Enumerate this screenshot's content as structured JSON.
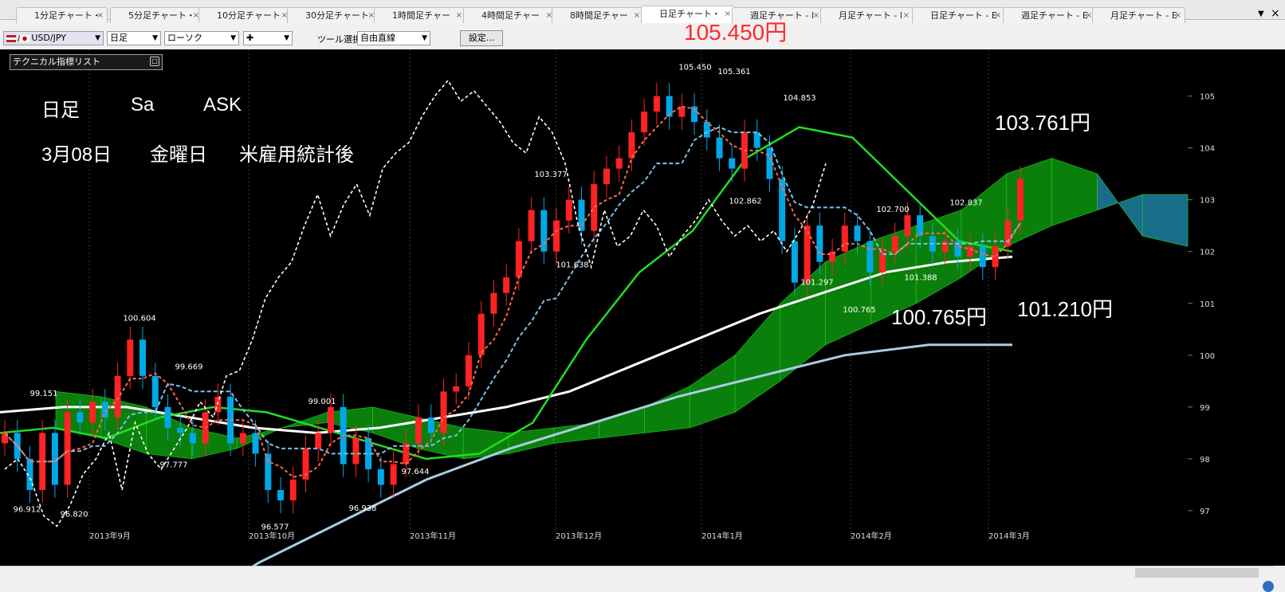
{
  "tabs": [
    {
      "label": "1分足チャート・",
      "active": false
    },
    {
      "label": "5分足チャート・",
      "active": false
    },
    {
      "label": "10分足チャート",
      "active": false
    },
    {
      "label": "30分足チャート",
      "active": false
    },
    {
      "label": "1時間足チャー",
      "active": false
    },
    {
      "label": "4時間足チャー",
      "active": false
    },
    {
      "label": "8時間足チャー",
      "active": false
    },
    {
      "label": "日足チャート・",
      "active": true
    },
    {
      "label": "週足チャート - l",
      "active": false
    },
    {
      "label": "月足チャート - l",
      "active": false
    },
    {
      "label": "日足チャート - E",
      "active": false
    },
    {
      "label": "週足チャート - E",
      "active": false
    },
    {
      "label": "月足チャート - E",
      "active": false
    }
  ],
  "toolbar": {
    "currency": "USD/JPY",
    "timeframe": "日足",
    "chart_style": "ローソク",
    "cursor_mode": "✚",
    "tool_label": "ツール選択",
    "tool_select": "自由直線",
    "settings_label": "設定..."
  },
  "price_header": "105.450円",
  "indicator_list": "テクニカル指標リスト",
  "annotations": {
    "line1": [
      "日足",
      "Sa",
      "ASK"
    ],
    "line2": [
      "3月08日",
      "金曜日",
      "米雇用統計後"
    ],
    "price_current": "103.761円",
    "price_low": "100.765円",
    "price_ma": "101.210円"
  },
  "colors": {
    "bull_candle": "#ff2323",
    "bear_candle": "#00a8e8",
    "kumo_bull": "#0b7f0b",
    "kumo_bear": "#186d89",
    "tenkan": "#ff6b4d",
    "kijun": "#7ec0e8",
    "chikou": "#ffffff",
    "ma_short": "#22dd22",
    "ma_long": "#ffffff",
    "ma_longer": "#a9cde4"
  },
  "chart_data": {
    "type": "candlestick",
    "title": "",
    "xlabel": "",
    "ylabel": "",
    "ylim": [
      96.4,
      105.9
    ],
    "y_ticks": [
      97,
      98,
      99,
      100,
      101,
      102,
      103,
      104,
      105
    ],
    "x_ticks": [
      "2013年9月",
      "2013年10月",
      "2013年11月",
      "2013年12月",
      "2014年1月",
      "2014年2月",
      "2014年3月"
    ],
    "grid": "vertical-dotted",
    "price_labels": [
      {
        "text": "105.450",
        "value": 105.45
      },
      {
        "text": "105.361",
        "value": 105.361
      },
      {
        "text": "104.853",
        "value": 104.853
      },
      {
        "text": "103.377",
        "value": 103.377
      },
      {
        "text": "102.862",
        "value": 102.862
      },
      {
        "text": "102.837",
        "value": 102.837
      },
      {
        "text": "102.700",
        "value": 102.7
      },
      {
        "text": "101.638",
        "value": 101.638
      },
      {
        "text": "101.297",
        "value": 101.297
      },
      {
        "text": "101.388",
        "value": 101.388
      },
      {
        "text": "100.765",
        "value": 100.765
      },
      {
        "text": "100.604",
        "value": 100.604
      },
      {
        "text": "99.669",
        "value": 99.669
      },
      {
        "text": "99.151",
        "value": 99.151
      },
      {
        "text": "99.001",
        "value": 99.001
      },
      {
        "text": "97.777",
        "value": 97.777
      },
      {
        "text": "97.644",
        "value": 97.644
      },
      {
        "text": "96.912",
        "value": 96.912
      },
      {
        "text": "96.820",
        "value": 96.82
      },
      {
        "text": "96.938",
        "value": 96.938
      },
      {
        "text": "96.577",
        "value": 96.577
      }
    ],
    "series": [
      {
        "name": "price_path",
        "values": [
          98.5,
          98.0,
          97.4,
          98.5,
          97.5,
          98.9,
          98.7,
          99.1,
          98.8,
          99.6,
          100.3,
          99.6,
          99.0,
          98.6,
          98.5,
          98.3,
          98.9,
          99.2,
          98.3,
          98.5,
          98.1,
          97.4,
          97.2,
          97.6,
          98.2,
          98.5,
          99.0,
          97.9,
          98.4,
          97.8,
          97.5,
          97.9,
          98.3,
          98.8,
          98.5,
          99.3,
          99.4,
          100.0,
          100.8,
          101.2,
          101.5,
          102.2,
          102.8,
          102.0,
          102.6,
          103.0,
          102.4,
          103.3,
          103.6,
          103.8,
          104.3,
          104.7,
          105.0,
          104.6,
          104.8,
          104.5,
          104.2,
          103.8,
          103.6,
          104.3,
          104.0,
          103.4,
          102.2,
          101.4,
          102.5,
          101.8,
          102.0,
          102.5,
          102.2,
          101.6,
          102.0,
          102.3,
          102.7,
          102.3,
          102.0,
          102.2,
          101.9,
          102.1,
          101.7,
          102.1,
          102.6,
          103.4
        ]
      },
      {
        "name": "ma_short",
        "values": [
          98.5,
          98.6,
          98.4,
          98.8,
          99.0,
          98.9,
          98.6,
          98.3,
          98.0,
          98.1,
          98.7,
          100.3,
          101.6,
          102.4,
          103.8,
          104.4,
          104.2,
          103.2,
          102.2,
          102.0
        ]
      },
      {
        "name": "ma_long",
        "values": [
          98.9,
          99.0,
          99.0,
          98.8,
          98.6,
          98.5,
          98.6,
          98.8,
          99.0,
          99.3,
          99.8,
          100.3,
          100.8,
          101.2,
          101.6,
          101.8,
          101.9
        ]
      },
      {
        "name": "ma_longer",
        "values": [
          95.0,
          96.0,
          96.8,
          97.6,
          98.2,
          98.7,
          99.2,
          99.6,
          100.0,
          100.2,
          100.2
        ]
      }
    ]
  }
}
